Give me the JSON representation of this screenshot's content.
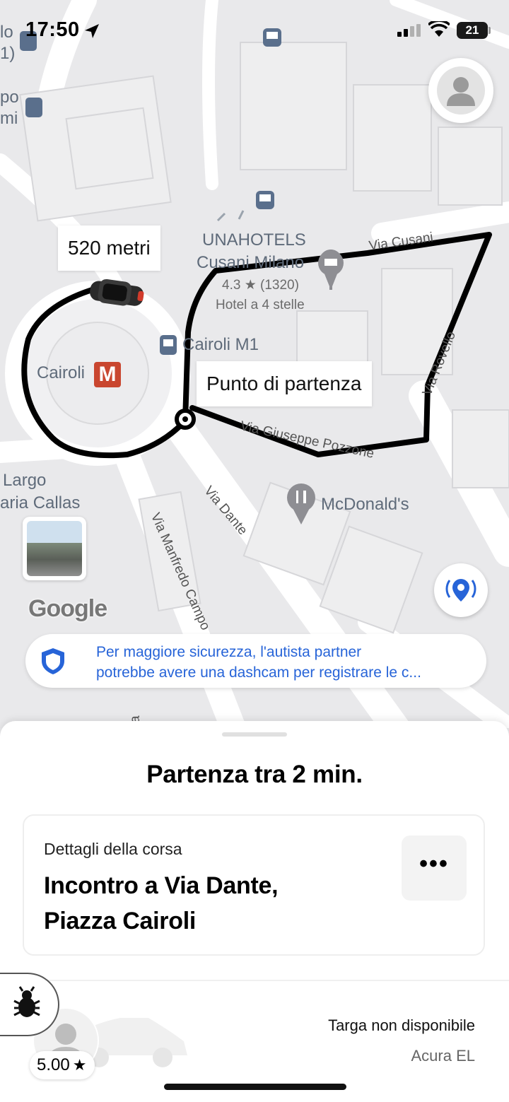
{
  "status_bar": {
    "time": "17:50",
    "battery": "21"
  },
  "map": {
    "distance_label": "520 metri",
    "pickup_label": "Punto di partenza",
    "metro_station": "Cairoli",
    "metro_symbol": "M",
    "tram_stop": "Cairoli M1",
    "hotel_name_line1": "UNAHOTELS",
    "hotel_name_line2": "Cusani Milano",
    "hotel_rating": "4.3",
    "hotel_reviews": "(1320)",
    "hotel_category": "Hotel a 4 stelle",
    "restaurant": "McDonald's",
    "street_cusani": "Via Cusani",
    "street_rovello": "Via Rovello",
    "street_pozzone": "Via Giuseppe Pozzone",
    "street_dante": "Via Dante",
    "street_manfredo": "Via Manfredo Campo",
    "largo_line1": "Largo",
    "largo_line2": "aria Callas",
    "edge_label_1": "lo",
    "edge_label_2": "1)",
    "edge_label_3": "po",
    "edge_label_4": "mi",
    "google_logo": "Google",
    "bottom_street_fragment": "a"
  },
  "safety_banner": {
    "text_line1": "Per maggiore sicurezza, l'autista partner",
    "text_line2": "potrebbe avere una dashcam per registrare le c..."
  },
  "sheet": {
    "heading": "Partenza tra 2 min.",
    "details_label": "Dettagli della corsa",
    "details_address_line1": "Incontro a Via Dante,",
    "details_address_line2": "Piazza Cairoli",
    "more_button": "•••",
    "driver_rating": "5.00",
    "plate": "Targa non disponibile",
    "car_model": "Acura EL"
  },
  "colors": {
    "accent_blue": "#2764d8",
    "metro_red": "#c9462f",
    "route": "#000000"
  }
}
